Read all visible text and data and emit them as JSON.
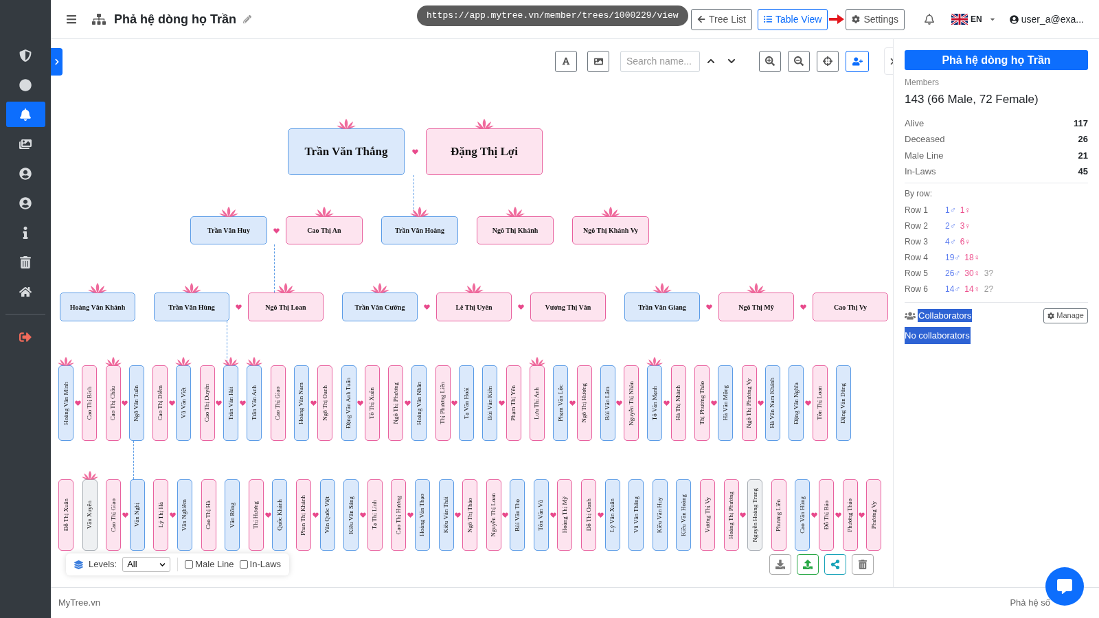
{
  "sidebar": {
    "items": [
      {
        "selected": false
      },
      {
        "selected": false
      },
      {
        "selected": true
      },
      {
        "selected": false
      },
      {
        "selected": false
      },
      {
        "selected": false
      },
      {
        "selected": false
      },
      {
        "selected": false
      },
      {
        "selected": false
      },
      {
        "selected": false
      }
    ]
  },
  "header": {
    "title": "Phả hệ dòng họ Trần",
    "url": "https://app.mytree.vn/member/trees/1000229/view",
    "buttons": [
      {
        "label": "Tree List",
        "selected": false
      },
      {
        "label": "Table View",
        "selected": true
      },
      {
        "label": "Settings",
        "selected": false
      }
    ],
    "language": "EN",
    "user": "user_a@exa..."
  },
  "toolbar": {
    "search_placeholder": "Search name..."
  },
  "tree": {
    "generations": [
      [
        {
          "name": "Trần Văn Thắng",
          "kind": "male",
          "lotus": true,
          "heart": true
        },
        {
          "name": "Đặng Thị Lợi",
          "kind": "female",
          "lotus": true,
          "heart": false
        }
      ],
      [
        {
          "name": "Trần Văn Huy",
          "kind": "male",
          "lotus": true,
          "heart": true
        },
        {
          "name": "Cao Thị An",
          "kind": "female",
          "lotus": true,
          "heart": false
        },
        {
          "name": "Trần Văn Hoàng",
          "kind": "male",
          "lotus": true,
          "heart": false
        },
        {
          "name": "Ngô Thị Khánh",
          "kind": "female",
          "lotus": true,
          "heart": false
        },
        {
          "name": "Ngô Thị Khánh Vy",
          "kind": "female",
          "lotus": true,
          "heart": false
        }
      ],
      [
        {
          "name": "Hoàng Văn Khánh",
          "kind": "male",
          "lotus": true,
          "heart": false
        },
        {
          "name": "Trần Văn Hùng",
          "kind": "male",
          "lotus": true,
          "heart": true
        },
        {
          "name": "Ngô Thị Loan",
          "kind": "female",
          "lotus": true,
          "heart": false
        },
        {
          "name": "Trần Văn Cường",
          "kind": "male",
          "lotus": true,
          "heart": true
        },
        {
          "name": "Lê Thị Uyên",
          "kind": "female",
          "lotus": true,
          "heart": true
        },
        {
          "name": "Vương Thị Vân",
          "kind": "female",
          "lotus": false,
          "heart": false
        },
        {
          "name": "Trần Văn Giang",
          "kind": "male",
          "lotus": true,
          "heart": true
        },
        {
          "name": "Ngô Thị Mỹ",
          "kind": "female",
          "lotus": true,
          "heart": true
        },
        {
          "name": "Cao Thị Vy",
          "kind": "female",
          "lotus": false
        }
      ],
      [
        {
          "name": "Hoàng Văn Minh",
          "kind": "male",
          "lotus": true,
          "heart": true
        },
        {
          "name": "Cao Thị Bích",
          "kind": "female",
          "lotus": false,
          "heart": false
        },
        {
          "name": "Cao Thị Châu",
          "kind": "female",
          "lotus": true,
          "heart": true
        },
        {
          "name": "Ngô Văn Tuấn",
          "kind": "male",
          "lotus": false,
          "heart": false
        },
        {
          "name": "Cao Thị Diễm",
          "kind": "female",
          "lotus": false,
          "heart": true
        },
        {
          "name": "Vũ Văn Việt",
          "kind": "male",
          "lotus": true,
          "heart": false
        },
        {
          "name": "Cao Thị Duyên",
          "kind": "female",
          "lotus": false,
          "heart": true
        },
        {
          "name": "Trần Văn Hải",
          "kind": "male",
          "lotus": true,
          "heart": true
        },
        {
          "name": "Trần Văn Anh",
          "kind": "male",
          "lotus": true,
          "heart": false
        },
        {
          "name": "Cao Thị Giao",
          "kind": "female",
          "lotus": false,
          "heart": false
        },
        {
          "name": "Hoàng Văn Nam",
          "kind": "male",
          "lotus": false,
          "heart": true
        },
        {
          "name": "Ngô Thị Oanh",
          "kind": "female",
          "lotus": false,
          "heart": false
        },
        {
          "name": "Đặng Văn Anh Tuấn",
          "kind": "male",
          "lotus": false,
          "heart": true
        },
        {
          "name": "Tô Thị Xuân",
          "kind": "female",
          "lotus": false,
          "heart": false
        },
        {
          "name": "Ngô Thị Phương",
          "kind": "female",
          "lotus": false,
          "heart": true
        },
        {
          "name": "Hoàng Văn Nhân",
          "kind": "male",
          "lotus": false,
          "heart": false
        },
        {
          "name": "Thị Phương Liên",
          "kind": "female",
          "lotus": false,
          "heart": true
        },
        {
          "name": "Tạ Văn Hoài",
          "kind": "male",
          "lotus": false,
          "heart": false
        },
        {
          "name": "Bùi Văn Kiên",
          "kind": "male",
          "lotus": false,
          "heart": true
        },
        {
          "name": "Phạm Thị Yến",
          "kind": "female",
          "lotus": false,
          "heart": false
        },
        {
          "name": "Lưu Thị Anh",
          "kind": "female",
          "lotus": true,
          "heart": false
        },
        {
          "name": "Phạm Văn Lộc",
          "kind": "male",
          "lotus": false,
          "heart": true
        },
        {
          "name": "Ngô Thị Hương",
          "kind": "female",
          "lotus": false,
          "heart": false
        },
        {
          "name": "Bùi Văn Lâm",
          "kind": "male",
          "lotus": false,
          "heart": true
        },
        {
          "name": "Nguyễn Thị Nhàn",
          "kind": "female",
          "lotus": false,
          "heart": false
        },
        {
          "name": "Tô Văn Mạnh",
          "kind": "male",
          "lotus": true,
          "heart": true
        },
        {
          "name": "Hà Thị Nhành",
          "kind": "female",
          "lotus": false,
          "heart": false
        },
        {
          "name": "Thị Phương Thảo",
          "kind": "female",
          "lotus": false,
          "heart": true
        },
        {
          "name": "Hà Văn Mộng",
          "kind": "male",
          "lotus": false,
          "heart": false
        },
        {
          "name": "Ngô Thị Phương Vy",
          "kind": "female",
          "lotus": false,
          "heart": true
        },
        {
          "name": "Hà Văn Nam Khánh",
          "kind": "male",
          "lotus": false,
          "heart": false
        },
        {
          "name": "Đặng Văn Nghĩa",
          "kind": "male",
          "lotus": false,
          "heart": true
        },
        {
          "name": "Tôn Thị Loan",
          "kind": "female",
          "lotus": false,
          "heart": false
        },
        {
          "name": "Đặng Văn Dũng",
          "kind": "male",
          "lotus": false,
          "heart": false
        }
      ],
      [
        {
          "name": "Đỗ Thị Xuân",
          "kind": "female",
          "lotus": false,
          "heart": false
        },
        {
          "name": "Văn Xuyên",
          "kind": "unknown",
          "lotus": true,
          "heart": false
        },
        {
          "name": "Cao Thị Giao",
          "kind": "female",
          "lotus": false,
          "heart": true
        },
        {
          "name": "Văn Nghị",
          "kind": "male",
          "lotus": false,
          "heart": false
        },
        {
          "name": "Lý Thị Hà",
          "kind": "female",
          "lotus": false,
          "heart": true
        },
        {
          "name": "Văn Nghiêm",
          "kind": "male",
          "lotus": false,
          "heart": false
        },
        {
          "name": "Cao Thị Hà",
          "kind": "female",
          "lotus": false,
          "heart": false
        },
        {
          "name": "Văn Rồng",
          "kind": "male",
          "lotus": false,
          "heart": false
        },
        {
          "name": "Thị Hương",
          "kind": "female",
          "lotus": false,
          "heart": true
        },
        {
          "name": "Quốc Khánh",
          "kind": "male",
          "lotus": false,
          "heart": false
        },
        {
          "name": "Phan Thị Khánh",
          "kind": "female",
          "lotus": false,
          "heart": true
        },
        {
          "name": "Văn Quốc Việt",
          "kind": "male",
          "lotus": false,
          "heart": false
        },
        {
          "name": "Kiều Văn Sáng",
          "kind": "male",
          "lotus": false,
          "heart": true
        },
        {
          "name": "Tạ Thị Linh",
          "kind": "female",
          "lotus": false,
          "heart": false
        },
        {
          "name": "Cao Thị Hương",
          "kind": "female",
          "lotus": false,
          "heart": true
        },
        {
          "name": "Hoàng Văn Thạo",
          "kind": "male",
          "lotus": false,
          "heart": false
        },
        {
          "name": "Kiều Văn Thái",
          "kind": "male",
          "lotus": false,
          "heart": true
        },
        {
          "name": "Ngô Thị Thảo",
          "kind": "female",
          "lotus": false,
          "heart": false
        },
        {
          "name": "Nguyễn Thị Loan",
          "kind": "female",
          "lotus": false,
          "heart": true
        },
        {
          "name": "Bùi Văn Thọ",
          "kind": "male",
          "lotus": false,
          "heart": false
        },
        {
          "name": "Tôn Văn Vũ",
          "kind": "male",
          "lotus": false,
          "heart": true
        },
        {
          "name": "Hoàng Thị Mỹ",
          "kind": "female",
          "lotus": false,
          "heart": false
        },
        {
          "name": "Đỗ Thị Oanh",
          "kind": "female",
          "lotus": false,
          "heart": true
        },
        {
          "name": "Lý Văn Xuân",
          "kind": "male",
          "lotus": false,
          "heart": false
        },
        {
          "name": "Vũ Văn Thắng",
          "kind": "male",
          "lotus": false,
          "heart": false
        },
        {
          "name": "Kiều Văn Huy",
          "kind": "male",
          "lotus": false,
          "heart": false
        },
        {
          "name": "Kiều Văn Hoàng",
          "kind": "male",
          "lotus": false,
          "heart": false
        },
        {
          "name": "Vương Thị Vy",
          "kind": "female",
          "lotus": false,
          "heart": false
        },
        {
          "name": "Hoàng Thị Phương",
          "kind": "female",
          "lotus": false,
          "heart": true
        },
        {
          "name": "Nguyễn Hoàng Trung",
          "kind": "unknown",
          "lotus": false,
          "heart": false
        },
        {
          "name": "Phương Liên",
          "kind": "female",
          "lotus": false,
          "heart": false
        },
        {
          "name": "Cao Văn Hùng",
          "kind": "male",
          "lotus": false,
          "heart": true
        },
        {
          "name": "Đỗ Thị Bảo",
          "kind": "female",
          "lotus": false,
          "heart": true
        },
        {
          "name": "Phương Thảo",
          "kind": "female",
          "lotus": false,
          "heart": true
        },
        {
          "name": "Phương Vy",
          "kind": "female",
          "lotus": false,
          "heart": false
        }
      ]
    ]
  },
  "legend": {
    "label": "Levels:",
    "select_value": "All",
    "checkboxes": [
      {
        "label": "Male Line",
        "checked": false
      },
      {
        "label": "In-Laws",
        "checked": false
      }
    ]
  },
  "panel": {
    "title": "Phả hệ dòng họ Trần",
    "members_label": "Members",
    "members_value": "143 (66 Male, 72 Female)",
    "stats": [
      {
        "label": "Alive",
        "value": "117"
      },
      {
        "label": "Deceased",
        "value": "26"
      },
      {
        "label": "Male Line",
        "value": "21"
      },
      {
        "label": "In-Laws",
        "value": "45"
      }
    ],
    "by_row_label": "By row:",
    "rows": [
      {
        "label": "Row 1",
        "male": "1♂",
        "female": "1♀"
      },
      {
        "label": "Row 2",
        "male": "2♂",
        "female": "3♀"
      },
      {
        "label": "Row 3",
        "male": "4♂",
        "female": "6♀"
      },
      {
        "label": "Row 4",
        "male": "19♂",
        "female": "18♀"
      },
      {
        "label": "Row 5",
        "male": "26♂",
        "female": "30♀",
        "unknown": "3?"
      },
      {
        "label": "Row 6",
        "male": "14♂",
        "female": "14♀",
        "unknown": "2?"
      }
    ],
    "collaborators_label": "Collaborators",
    "manage_button": "Manage",
    "no_collaborators": "No collaborators"
  },
  "footer": {
    "left": "MyTree.vn",
    "right": "Phả hệ số"
  }
}
